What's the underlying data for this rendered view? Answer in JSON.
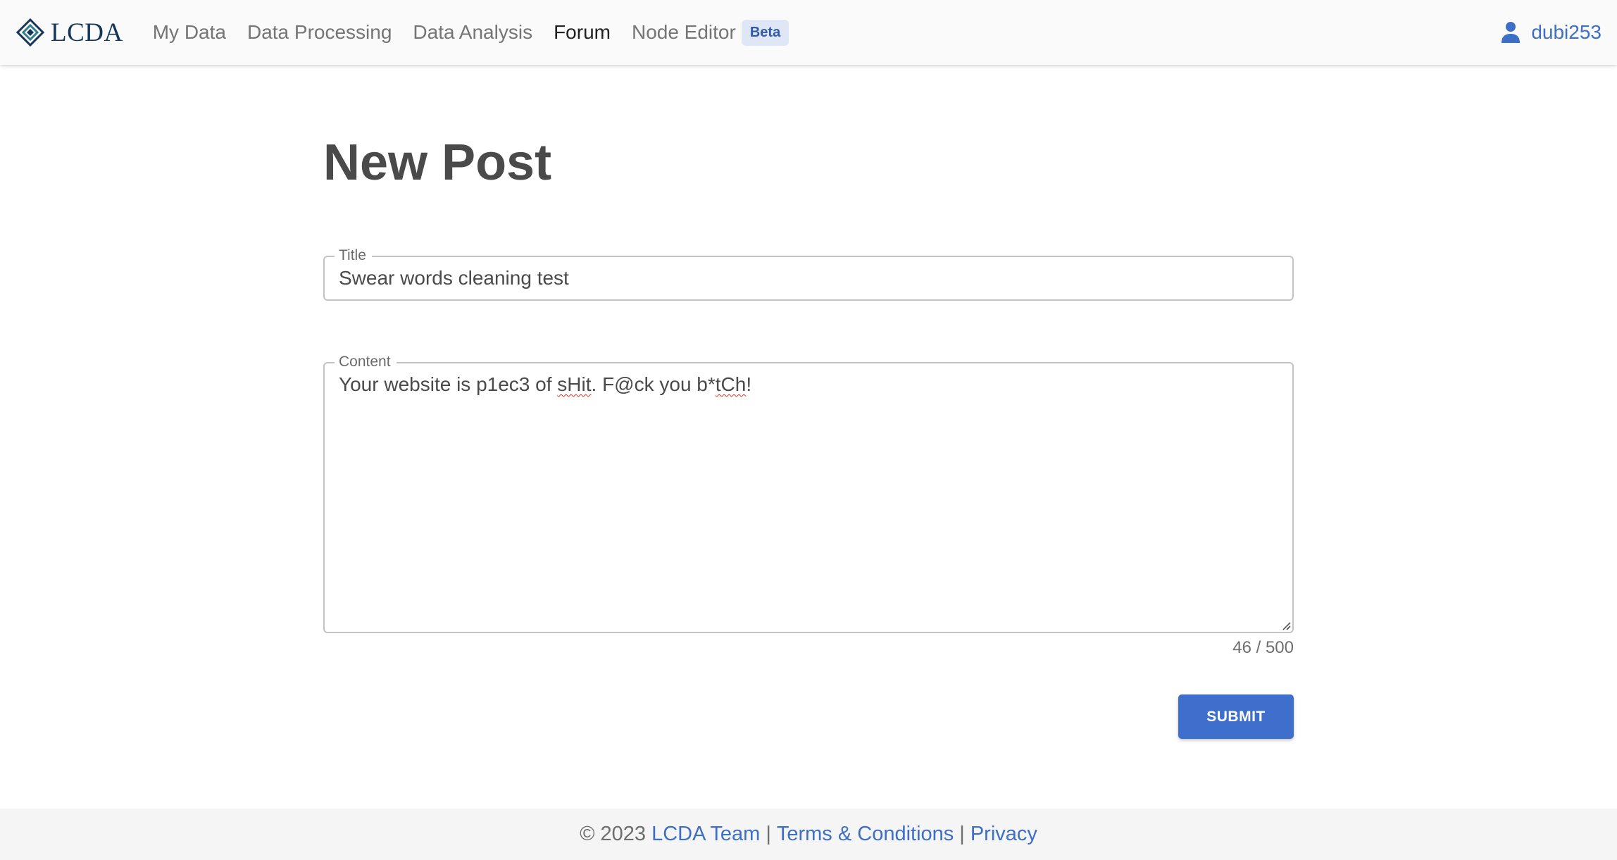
{
  "brand": {
    "name": "LCDA"
  },
  "nav": {
    "items": [
      {
        "label": "My Data"
      },
      {
        "label": "Data Processing"
      },
      {
        "label": "Data Analysis"
      },
      {
        "label": "Forum"
      },
      {
        "label": "Node Editor"
      }
    ],
    "active": "Forum",
    "beta_badge": "Beta"
  },
  "user": {
    "name": "dubi253",
    "icon": "person-icon"
  },
  "page": {
    "title": "New Post"
  },
  "form": {
    "title_label": "Title",
    "title_value": "Swear words cleaning test",
    "content_label": "Content",
    "content_parts": {
      "p1": "Your website is p1ec3 of ",
      "w1": "sHit",
      "p2": ". F@ck you b*",
      "w2": "tCh",
      "p3": "!"
    },
    "char_count": "46 / 500",
    "submit_label": "SUBMIT"
  },
  "footer": {
    "copyright": "© 2023",
    "team": "LCDA Team",
    "separator": "|",
    "terms": "Terms & Conditions",
    "privacy": "Privacy"
  },
  "colors": {
    "accent": "#3f6fcc",
    "link": "#3e6fc7",
    "brand": "#14365a",
    "badge_bg": "#dfe7f6"
  }
}
